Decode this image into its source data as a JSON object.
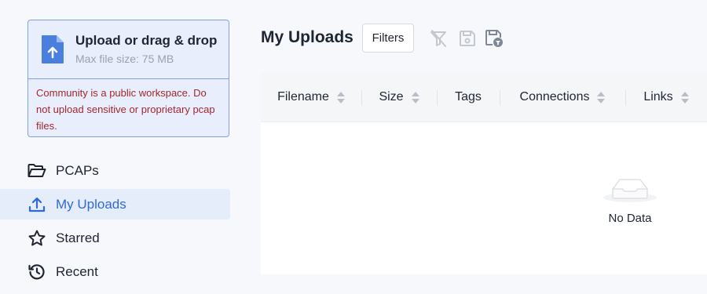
{
  "upload": {
    "title": "Upload or drag & drop",
    "subtitle": "Max file size: 75 MB",
    "warning": "Community is a public workspace. Do not upload sensitive or proprietary pcap files.",
    "icon": "file-upload-icon"
  },
  "nav": {
    "items": [
      {
        "label": "PCAPs",
        "icon": "folder-open-icon",
        "active": false
      },
      {
        "label": "My Uploads",
        "icon": "upload-icon",
        "active": true
      },
      {
        "label": "Starred",
        "icon": "star-icon",
        "active": false
      },
      {
        "label": "Recent",
        "icon": "history-icon",
        "active": false
      }
    ]
  },
  "main": {
    "title": "My Uploads",
    "filters_label": "Filters",
    "toolbar_icons": [
      "clear-filter-icon",
      "save-icon",
      "save-filter-icon"
    ]
  },
  "table": {
    "columns": [
      {
        "label": "Filename",
        "sortable": true
      },
      {
        "label": "Size",
        "sortable": true
      },
      {
        "label": "Tags",
        "sortable": false
      },
      {
        "label": "Connections",
        "sortable": true
      },
      {
        "label": "Links",
        "sortable": true
      }
    ],
    "empty_text": "No Data"
  },
  "colors": {
    "accent": "#2f6bd8",
    "warning": "#a3282c",
    "upload_bg": "#e8eefc",
    "active_nav_bg": "#e5ecfa"
  }
}
